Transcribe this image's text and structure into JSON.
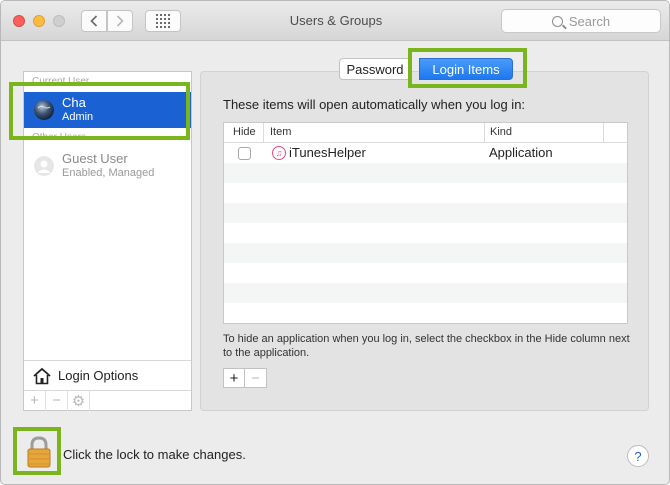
{
  "window": {
    "title": "Users & Groups"
  },
  "toolbar": {
    "back_icon": "chevron-left-icon",
    "forward_icon": "chevron-right-icon",
    "grid_icon": "grid-icon",
    "search_placeholder": "Search"
  },
  "sidebar": {
    "current_users_header": "Current User",
    "other_users_header": "Other Users",
    "current_user": {
      "name": "Cha",
      "role": "Admin"
    },
    "other_users": [
      {
        "name": "Guest User",
        "role": "Enabled, Managed"
      }
    ],
    "login_options_label": "Login Options",
    "tools": [
      "+",
      "−",
      "⚙"
    ]
  },
  "tabs": {
    "password": "Password",
    "login_items": "Login Items",
    "selected": "login_items"
  },
  "login_items": {
    "intro": "These items will open automatically when you log in:",
    "columns": {
      "hide": "Hide",
      "item": "Item",
      "kind": "Kind"
    },
    "rows": [
      {
        "hide": false,
        "item": "iTunesHelper",
        "kind": "Application"
      }
    ],
    "hint": "To hide an application when you log in, select the checkbox in the Hide column next to the application.",
    "add_label": "+",
    "remove_label": "−"
  },
  "footer": {
    "lock_text": "Click the lock to make changes.",
    "help_label": "?"
  },
  "colors": {
    "selection_blue": "#1a62d4",
    "tab_selected": "#1e78f0",
    "highlight_green": "#7ab51d",
    "lock_gold": "#e8a63a"
  }
}
